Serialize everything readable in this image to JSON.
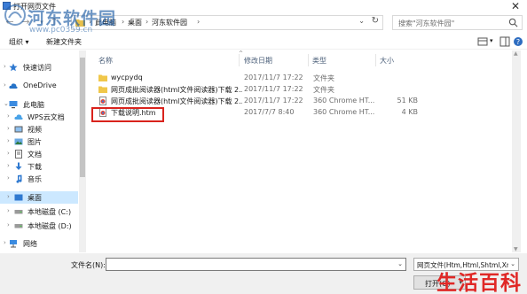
{
  "window": {
    "title": "打开网页文件"
  },
  "watermark": {
    "site_name": "河东软件园",
    "site_url": "www.pc0359.cn",
    "brand": "生活百科"
  },
  "address": {
    "crumbs": [
      "此电脑",
      "桌面",
      "河东软件园"
    ],
    "search_placeholder": "搜索\"河东软件园\""
  },
  "toolbar": {
    "organize": "组织 ▾",
    "new_folder": "新建文件夹"
  },
  "sidebar": {
    "items": [
      {
        "label": "快速访问",
        "icon": "star-icon"
      },
      {
        "label": "OneDrive",
        "icon": "cloud-icon"
      },
      {
        "label": "此电脑",
        "icon": "computer-icon"
      },
      {
        "label": "WPS云文档",
        "icon": "wps-cloud-icon"
      },
      {
        "label": "视频",
        "icon": "video-icon"
      },
      {
        "label": "图片",
        "icon": "picture-icon"
      },
      {
        "label": "文档",
        "icon": "document-icon"
      },
      {
        "label": "下载",
        "icon": "download-icon"
      },
      {
        "label": "音乐",
        "icon": "music-icon"
      },
      {
        "label": "桌面",
        "icon": "desktop-icon",
        "selected": true
      },
      {
        "label": "本地磁盘 (C:)",
        "icon": "drive-icon"
      },
      {
        "label": "本地磁盘 (D:)",
        "icon": "drive-icon"
      },
      {
        "label": "网络",
        "icon": "network-icon"
      }
    ]
  },
  "columns": {
    "name": "名称",
    "date": "修改日期",
    "type": "类型",
    "size": "大小"
  },
  "files": [
    {
      "name": "wycpydq",
      "date": "2017/11/7 17:22",
      "type": "文件夹",
      "size": "",
      "icon": "folder-icon"
    },
    {
      "name": "网页成批阅读器(html文件阅读器)下载 2...",
      "date": "2017/11/7 17:22",
      "type": "文件夹",
      "size": "",
      "icon": "folder-icon"
    },
    {
      "name": "网页成批阅读器(html文件阅读器)下载 2...",
      "date": "2017/11/7 17:22",
      "type": "360 Chrome HT...",
      "size": "51 KB",
      "icon": "chrome-html-icon"
    },
    {
      "name": "下载说明.htm",
      "date": "2017/7/7 8:40",
      "type": "360 Chrome HT...",
      "size": "4 KB",
      "icon": "chrome-html-icon"
    }
  ],
  "bottom": {
    "filename_label": "文件名(N):",
    "filename_value": "",
    "filter": "网页文件(Htm,Html,Shtml,Xm",
    "open_button": "打开(O)"
  },
  "colors": {
    "selection": "#cce8ff",
    "highlight_box": "#d9231d",
    "brand_red": "#e02826",
    "watermark_blue": "#1f5ea6"
  }
}
